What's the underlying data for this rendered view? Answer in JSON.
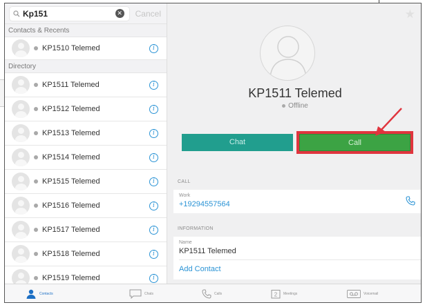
{
  "search": {
    "query": "Kp151",
    "cancel_label": "Cancel"
  },
  "sections": {
    "recents_label": "Contacts & Recents",
    "directory_label": "Directory"
  },
  "recents": [
    {
      "name": "KP1510 Telemed"
    }
  ],
  "directory": [
    {
      "name": "KP1511 Telemed"
    },
    {
      "name": "KP1512 Telemed"
    },
    {
      "name": "KP1513 Telemed"
    },
    {
      "name": "KP1514 Telemed"
    },
    {
      "name": "KP1515 Telemed"
    },
    {
      "name": "KP1516 Telemed"
    },
    {
      "name": "KP1517 Telemed"
    },
    {
      "name": "KP1518 Telemed"
    },
    {
      "name": "KP1519 Telemed"
    }
  ],
  "contact": {
    "name": "KP1511 Telemed",
    "status": "Offline",
    "chat_label": "Chat",
    "call_label": "Call"
  },
  "call_section": {
    "header": "CALL",
    "work_caption": "Work",
    "phone": "+19294557564"
  },
  "info_section": {
    "header": "INFORMATION",
    "name_caption": "Name",
    "name_value": "KP1511 Telemed",
    "add_contact_label": "Add Contact"
  },
  "tabs": [
    {
      "label": "Contacts",
      "icon": "person-icon",
      "active": true
    },
    {
      "label": "Chats",
      "icon": "chat-bubble-icon",
      "active": false
    },
    {
      "label": "Calls",
      "icon": "phone-icon",
      "active": false
    },
    {
      "label": "Meetings",
      "icon": "calendar-icon",
      "active": false,
      "badge": "2"
    },
    {
      "label": "Voicemail",
      "icon": "voicemail-icon",
      "active": false
    }
  ],
  "colors": {
    "accent_blue": "#2a93d5",
    "chat_teal": "#219e8e",
    "call_green": "#3ca344",
    "highlight_red": "#e0353e"
  }
}
